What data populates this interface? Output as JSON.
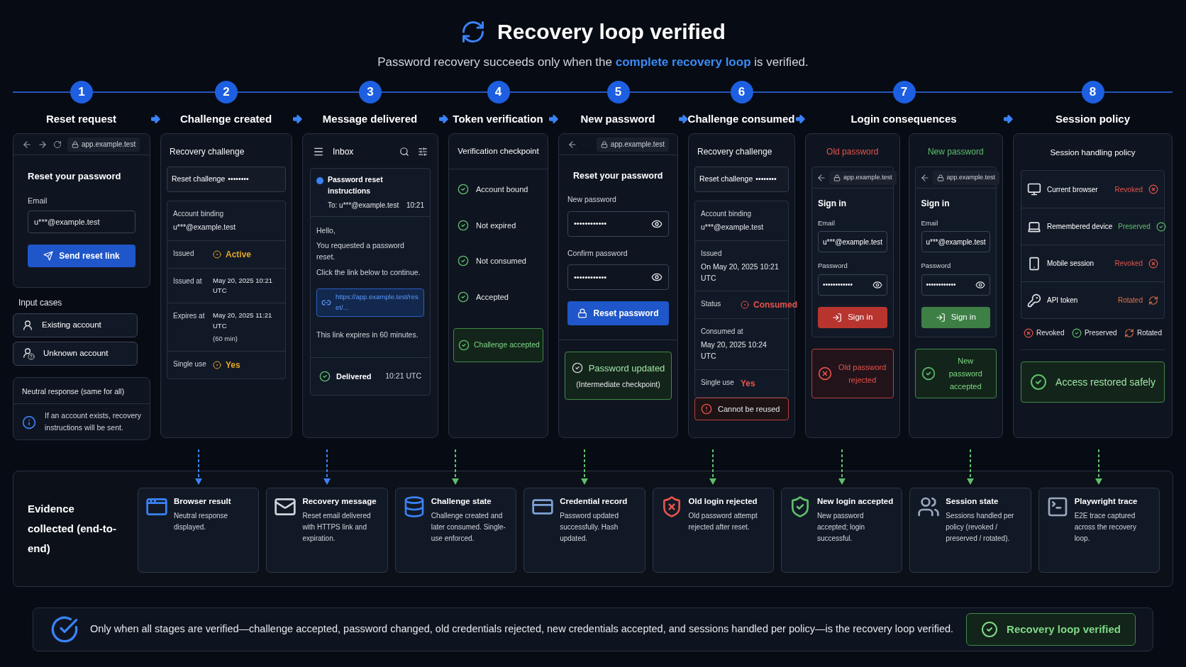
{
  "header": {
    "title": "Recovery loop verified",
    "subtitle": "Password recovery succeeds only when the **complete recovery loop** is verified."
  },
  "steps": [
    {
      "number": "1",
      "title": "Reset request",
      "kind": "reset_form",
      "url": "app.example.test",
      "heading": "Reset your password",
      "email_label": "Email",
      "email_value": "u***@example.test",
      "button": "Send reset link",
      "cases_title": "Input cases",
      "cases": [
        {
          "label": "Existing account",
          "kind": "known"
        },
        {
          "label": "Unknown account",
          "kind": "unknown"
        }
      ],
      "neutral_title": "Neutral response (same for all)",
      "neutral_text": "If an account exists, recovery instructions will be sent."
    },
    {
      "number": "2",
      "title": "Challenge created",
      "kind": "challenge",
      "heading": "Recovery challenge",
      "token_label": "Reset challenge",
      "token_mask": "••••••••",
      "rows": [
        {
          "kind": "stacked",
          "label": "Account binding",
          "value": "u***@example.test"
        },
        {
          "kind": "inline",
          "label": "Issued",
          "value": "Active",
          "color": "#e0a526",
          "dot": true
        },
        {
          "kind": "inline",
          "label": "Issued at",
          "value": "May 20, 2025 10:21 UTC"
        },
        {
          "kind": "inline",
          "label": "Expires at",
          "value": "May 20, 2025 11:21 UTC",
          "note": "(60 min)"
        },
        {
          "kind": "inline",
          "label": "Single use",
          "value": "Yes",
          "color": "#e0a526",
          "dot": true
        }
      ]
    },
    {
      "number": "3",
      "title": "Message delivered",
      "kind": "inbox",
      "inbox_title": "Inbox",
      "message": {
        "subject": "Password reset instructions",
        "to": "To: u***@example.test",
        "time": "10:21",
        "unread": true
      },
      "body": [
        "Hello,",
        "You requested a password reset.",
        "Click the link below to continue."
      ],
      "link": "https://app.example.test/reset/...",
      "expiry": "This link expires in 60 minutes.",
      "status": "Delivered",
      "status_time": "10:21 UTC"
    },
    {
      "number": "4",
      "title": "Token verification",
      "kind": "checklist",
      "heading": "Verification checkpoint",
      "checks": [
        {
          "label": "Account bound",
          "checked": true
        },
        {
          "label": "Not expired",
          "checked": true
        },
        {
          "label": "Not consumed",
          "checked": true
        },
        {
          "label": "Accepted",
          "checked": true
        }
      ],
      "result": "Challenge accepted"
    },
    {
      "number": "5",
      "title": "New password",
      "kind": "new_password",
      "url": "app.example.test",
      "heading": "Reset your password",
      "fields": [
        {
          "label": "New password",
          "value": "••••••••••••"
        },
        {
          "label": "Confirm password",
          "value": "••••••••••••"
        }
      ],
      "button": "Reset password",
      "result": "Password updated",
      "result_note": "(Intermediate checkpoint)"
    },
    {
      "number": "6",
      "title": "Challenge consumed",
      "kind": "challenge",
      "heading": "Recovery challenge",
      "token_label": "Reset challenge",
      "token_mask": "••••••••",
      "rows": [
        {
          "kind": "stacked",
          "label": "Account binding",
          "value": "u***@example.test"
        },
        {
          "kind": "stacked",
          "label": "Issued",
          "value": "On May 20, 2025 10:21 UTC"
        },
        {
          "kind": "inline",
          "label": "Status",
          "value": "Consumed",
          "color": "#e5534b",
          "dot": true
        },
        {
          "kind": "stacked",
          "label": "Consumed at",
          "value": "May 20, 2025 10:24 UTC"
        },
        {
          "kind": "inline",
          "label": "Single use",
          "value": "Yes",
          "color": "#e5534b",
          "dot": false
        }
      ],
      "alert": "Cannot be reused"
    },
    {
      "number": "7",
      "title": "Login consequences",
      "kind": "login",
      "panels": [
        {
          "title": "Old password",
          "kind": "rejected",
          "url": "app.example.test",
          "heading": "Sign in",
          "email_label": "Email",
          "email_value": "u***@example.test",
          "password_label": "Password",
          "password_value": "••••••••••••",
          "button": "Sign in",
          "result": "Old password rejected"
        },
        {
          "title": "New password",
          "kind": "accepted",
          "url": "app.example.test",
          "heading": "Sign in",
          "email_label": "Email",
          "email_value": "u***@example.test",
          "password_label": "Password",
          "password_value": "••••••••••••",
          "button": "Sign in",
          "result": "New password accepted"
        }
      ]
    },
    {
      "number": "8",
      "title": "Session policy",
      "kind": "session_policy",
      "heading": "Session handling policy",
      "sessions": [
        {
          "label": "Current browser",
          "status": "Revoked",
          "kind": "revoked"
        },
        {
          "label": "Remembered device",
          "status": "Preserved",
          "kind": "preserved"
        },
        {
          "label": "Mobile session",
          "status": "Revoked",
          "kind": "revoked"
        },
        {
          "label": "API token",
          "status": "Rotated",
          "kind": "rotated"
        }
      ],
      "legend": [
        {
          "label": "Revoked",
          "kind": "revoked"
        },
        {
          "label": "Preserved",
          "kind": "preserved"
        },
        {
          "label": "Rotated",
          "kind": "rotated"
        }
      ],
      "result": "Access restored safely"
    }
  ],
  "evidence": {
    "title": "Evidence collected (end-to-end)",
    "cards": [
      {
        "title": "Browser result",
        "text": "Neutral response displayed.",
        "color": "#3b82f6"
      },
      {
        "title": "Recovery message",
        "text": "Reset email delivered with HTTPS link and expiration.",
        "color": "#3b82f6"
      },
      {
        "title": "Challenge state",
        "text": "Challenge created and later consumed. Single-use enforced.",
        "color": "#5fbf6a"
      },
      {
        "title": "Credential record",
        "text": "Password updated successfully. Hash updated.",
        "color": "#5fbf6a"
      },
      {
        "title": "Old login rejected",
        "text": "Old password attempt rejected after reset.",
        "color": "#5fbf6a"
      },
      {
        "title": "New login accepted",
        "text": "New password accepted; login successful.",
        "color": "#5fbf6a"
      },
      {
        "title": "Session state",
        "text": "Sessions handled per policy (revoked / preserved / rotated).",
        "color": "#5fbf6a"
      },
      {
        "title": "Playwright trace",
        "text": "E2E trace captured across the recovery loop.",
        "color": "#5fbf6a"
      }
    ]
  },
  "footer": {
    "text": "Only when all stages are verified—challenge accepted, password changed, old credentials rejected, new credentials accepted, and sessions handled per policy—is the recovery loop verified.",
    "badge": "Recovery loop verified"
  }
}
